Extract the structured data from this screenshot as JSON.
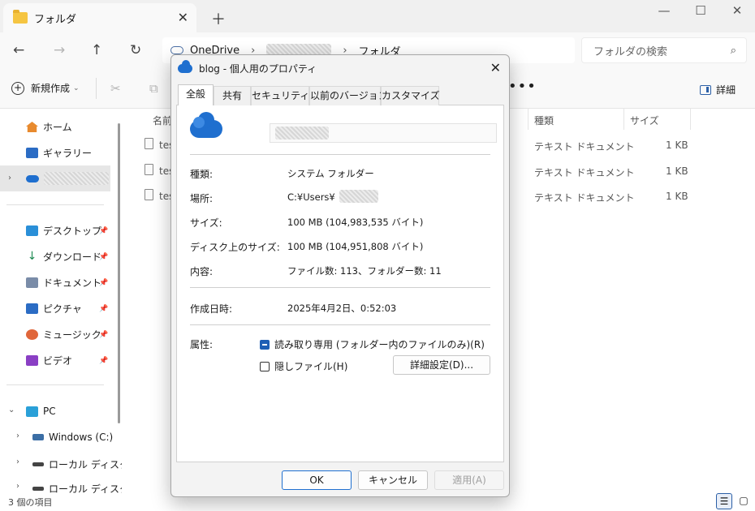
{
  "window": {
    "tab_title": "フォルダ",
    "tab_close": "✕",
    "new_tab": "＋",
    "controls": {
      "minimize": "—",
      "maximize": "☐",
      "close": "✕"
    }
  },
  "address": {
    "crumbs": [
      "OneDrive",
      "フォルダ"
    ],
    "search_placeholder": "フォルダの検索"
  },
  "toolbar": {
    "new_label": "新規作成",
    "details_label": "詳細",
    "more": "•••"
  },
  "sidebar": {
    "quick": [
      {
        "label": "ホーム"
      },
      {
        "label": "ギャラリー"
      }
    ],
    "pinned": [
      {
        "label": "デスクトップ"
      },
      {
        "label": "ダウンロード"
      },
      {
        "label": "ドキュメント"
      },
      {
        "label": "ピクチャ"
      },
      {
        "label": "ミュージック"
      },
      {
        "label": "ビデオ"
      }
    ],
    "pc": {
      "label": "PC",
      "drives": [
        "Windows (C:)",
        "ローカル ディスク",
        "ローカル ディスク"
      ]
    }
  },
  "file_list": {
    "columns": [
      "名前",
      "種類",
      "サイズ"
    ],
    "rows": [
      {
        "name": "tes",
        "type": "テキスト ドキュメント",
        "size": "1 KB"
      },
      {
        "name": "tes",
        "type": "テキスト ドキュメント",
        "size": "1 KB"
      },
      {
        "name": "tes",
        "type": "テキスト ドキュメント",
        "size": "1 KB"
      }
    ]
  },
  "status": {
    "count": "3 個の項目"
  },
  "dialog": {
    "title": "blog - 個人用のプロパティ",
    "close": "✕",
    "tabs": [
      "全般",
      "共有",
      "セキュリティ",
      "以前のバージョン",
      "カスタマイズ"
    ],
    "props": {
      "type_label": "種類:",
      "type_value": "システム フォルダー",
      "location_label": "場所:",
      "location_value": "C:¥Users¥",
      "size_label": "サイズ:",
      "size_value": "100 MB (104,983,535 バイト)",
      "disk_size_label": "ディスク上のサイズ:",
      "disk_size_value": "100 MB (104,951,808 バイト)",
      "contents_label": "内容:",
      "contents_value": "ファイル数: 113、フォルダー数: 11",
      "created_label": "作成日時:",
      "created_value": "2025年4月2日、0:52:03",
      "attributes_label": "属性:"
    },
    "attributes": {
      "readonly_label": "読み取り専用 (フォルダー内のファイルのみ)(R)",
      "readonly_state": "indeterminate",
      "hidden_label": "隠しファイル(H)",
      "hidden_checked": false,
      "advanced_button": "詳細設定(D)..."
    },
    "buttons": {
      "ok": "OK",
      "cancel": "キャンセル",
      "apply": "適用(A)"
    }
  },
  "colors": {
    "accent": "#1f6fcf",
    "onedrive": "#1f6fcf",
    "folder": "#f5c542"
  }
}
